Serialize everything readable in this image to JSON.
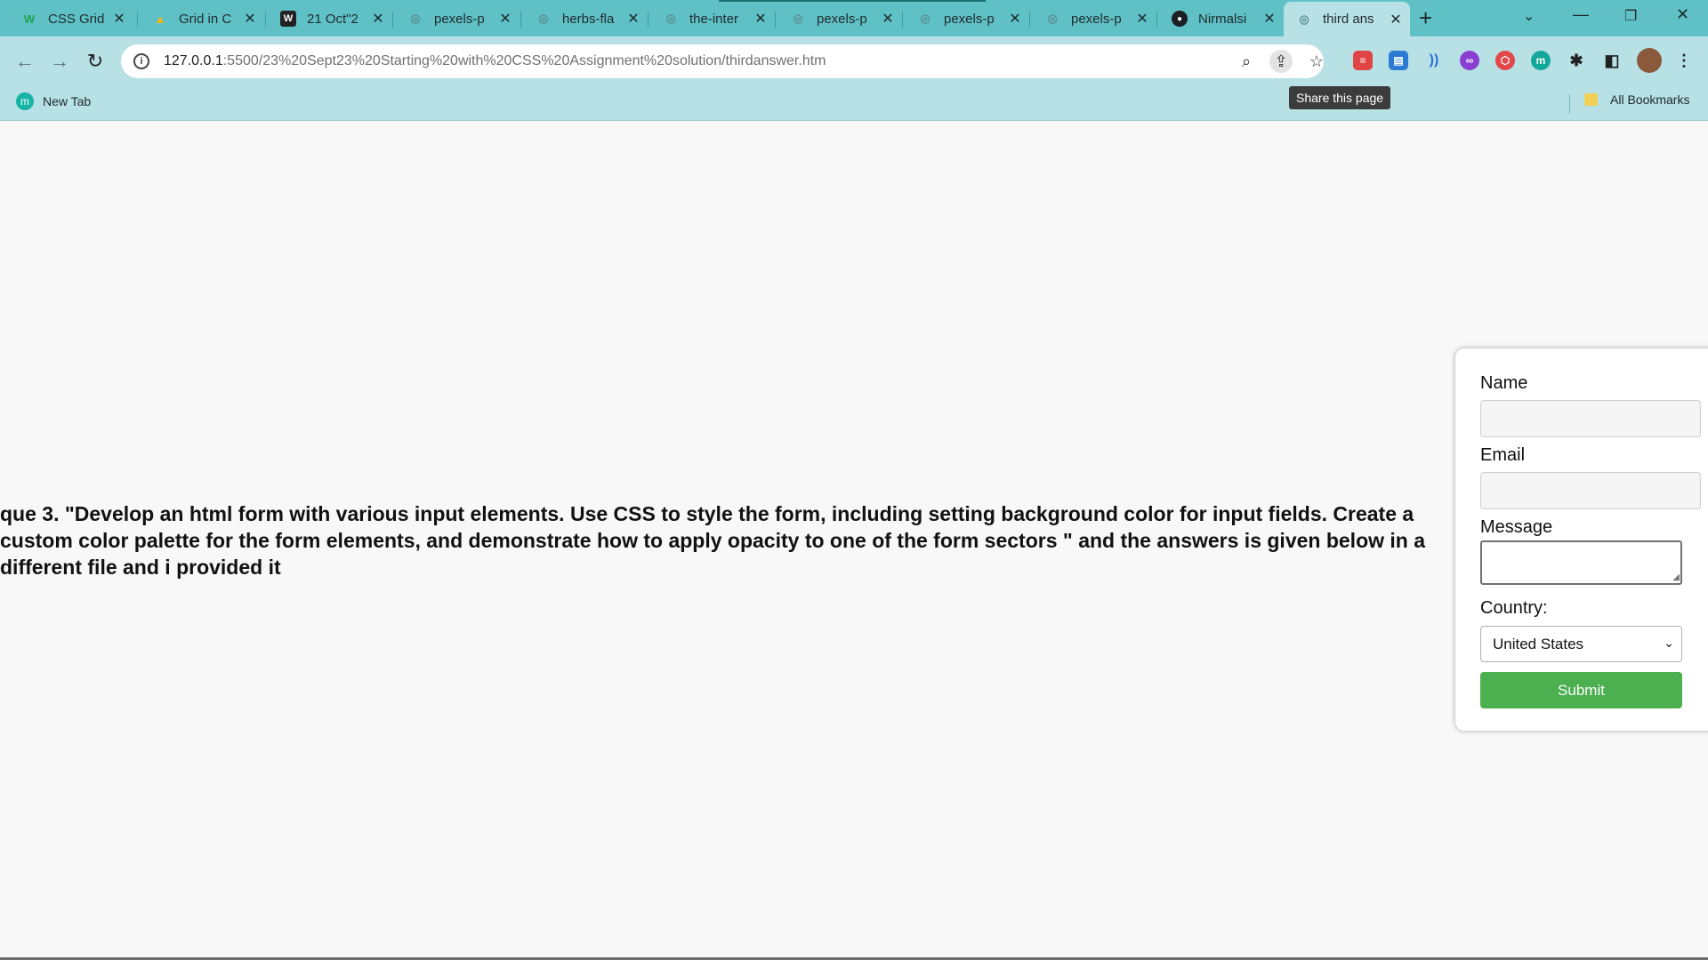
{
  "tabs": [
    {
      "title": "CSS Grid",
      "favicon": "w-logo-icon",
      "fav_text": "W"
    },
    {
      "title": "Grid in C",
      "favicon": "google-drive-icon",
      "fav_text": "▲"
    },
    {
      "title": "21 Oct\"2",
      "favicon": "wordpress-icon",
      "fav_text": "W"
    },
    {
      "title": "pexels-p",
      "favicon": "globe-icon",
      "fav_text": "◎"
    },
    {
      "title": "herbs-fla",
      "favicon": "globe-icon",
      "fav_text": "◎"
    },
    {
      "title": "the-inter",
      "favicon": "globe-icon",
      "fav_text": "◎"
    },
    {
      "title": "pexels-p",
      "favicon": "globe-icon",
      "fav_text": "◎"
    },
    {
      "title": "pexels-p",
      "favicon": "globe-icon",
      "fav_text": "◎"
    },
    {
      "title": "pexels-p",
      "favicon": "globe-icon",
      "fav_text": "◎"
    },
    {
      "title": "Nirmalsi",
      "favicon": "github-icon",
      "fav_text": "●"
    },
    {
      "title": "third ans",
      "favicon": "globe-icon",
      "fav_text": "◎",
      "active": true
    }
  ],
  "address_bar": {
    "host": "127.0.0.1",
    "path": ":5500/23%20Sept23%20Starting%20with%20CSS%20Assignment%20solution/thirdanswer.htm"
  },
  "tooltip": "Share this page",
  "bookmarks": {
    "new_tab": "New Tab",
    "all_bookmarks": "All Bookmarks"
  },
  "page": {
    "question": "que 3. \"Develop an html form with various input elements. Use CSS to style the form, including setting background color for input fields. Create a custom color palette for the form elements, and demonstrate how to apply opacity to one of the form sectors \" and the answers is given below in a different file and i provided it"
  },
  "form": {
    "name_label": "Name",
    "email_label": "Email",
    "message_label": "Message",
    "country_label": "Country:",
    "country_value": "United States",
    "submit_label": "Submit"
  },
  "colors": {
    "tabstrip": "#5fc1c6",
    "toolbar": "#b7e1e5",
    "submit": "#4caf50"
  }
}
